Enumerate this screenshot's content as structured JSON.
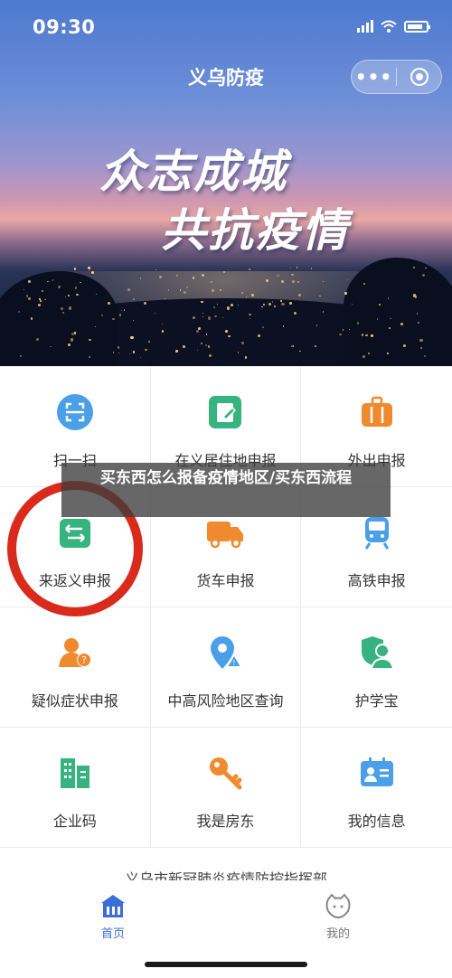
{
  "statusbar": {
    "time": "09:30"
  },
  "header": {
    "title": "义乌防疫",
    "more_icon": "more-dots-icon",
    "close_icon": "target-icon"
  },
  "banner": {
    "line1": "众志成城",
    "line2": "共抗疫情"
  },
  "grid": [
    {
      "label": "扫一扫",
      "icon": "scan-icon",
      "color": "#4a9fe8"
    },
    {
      "label": "在义居住地申报",
      "icon": "edit-icon",
      "color": "#36b37e"
    },
    {
      "label": "外出申报",
      "icon": "suitcase-icon",
      "color": "#f08a2e"
    },
    {
      "label": "来返义申报",
      "icon": "return-arrows-icon",
      "color": "#36b37e"
    },
    {
      "label": "货车申报",
      "icon": "truck-icon",
      "color": "#f08a2e"
    },
    {
      "label": "高铁申报",
      "icon": "train-icon",
      "color": "#4a9fe8"
    },
    {
      "label": "疑似症状申报",
      "icon": "person-question-icon",
      "color": "#f08a2e"
    },
    {
      "label": "中高风险地区查询",
      "icon": "location-warning-icon",
      "color": "#4a9fe8"
    },
    {
      "label": "护学宝",
      "icon": "shield-person-icon",
      "color": "#36b37e"
    },
    {
      "label": "企业码",
      "icon": "building-icon",
      "color": "#36b37e"
    },
    {
      "label": "我是房东",
      "icon": "key-icon",
      "color": "#f08a2e"
    },
    {
      "label": "我的信息",
      "icon": "id-card-icon",
      "color": "#4a9fe8"
    }
  ],
  "watermark": {
    "text": "买东西怎么报备疫情地区/买东西流程"
  },
  "notice": {
    "text": "义乌市新冠肺炎疫情防控指挥部"
  },
  "tabs": {
    "home": "首页",
    "mine": "我的"
  },
  "colors": {
    "accent": "#3b6fd8",
    "highlight_circle": "#d92a1c"
  }
}
